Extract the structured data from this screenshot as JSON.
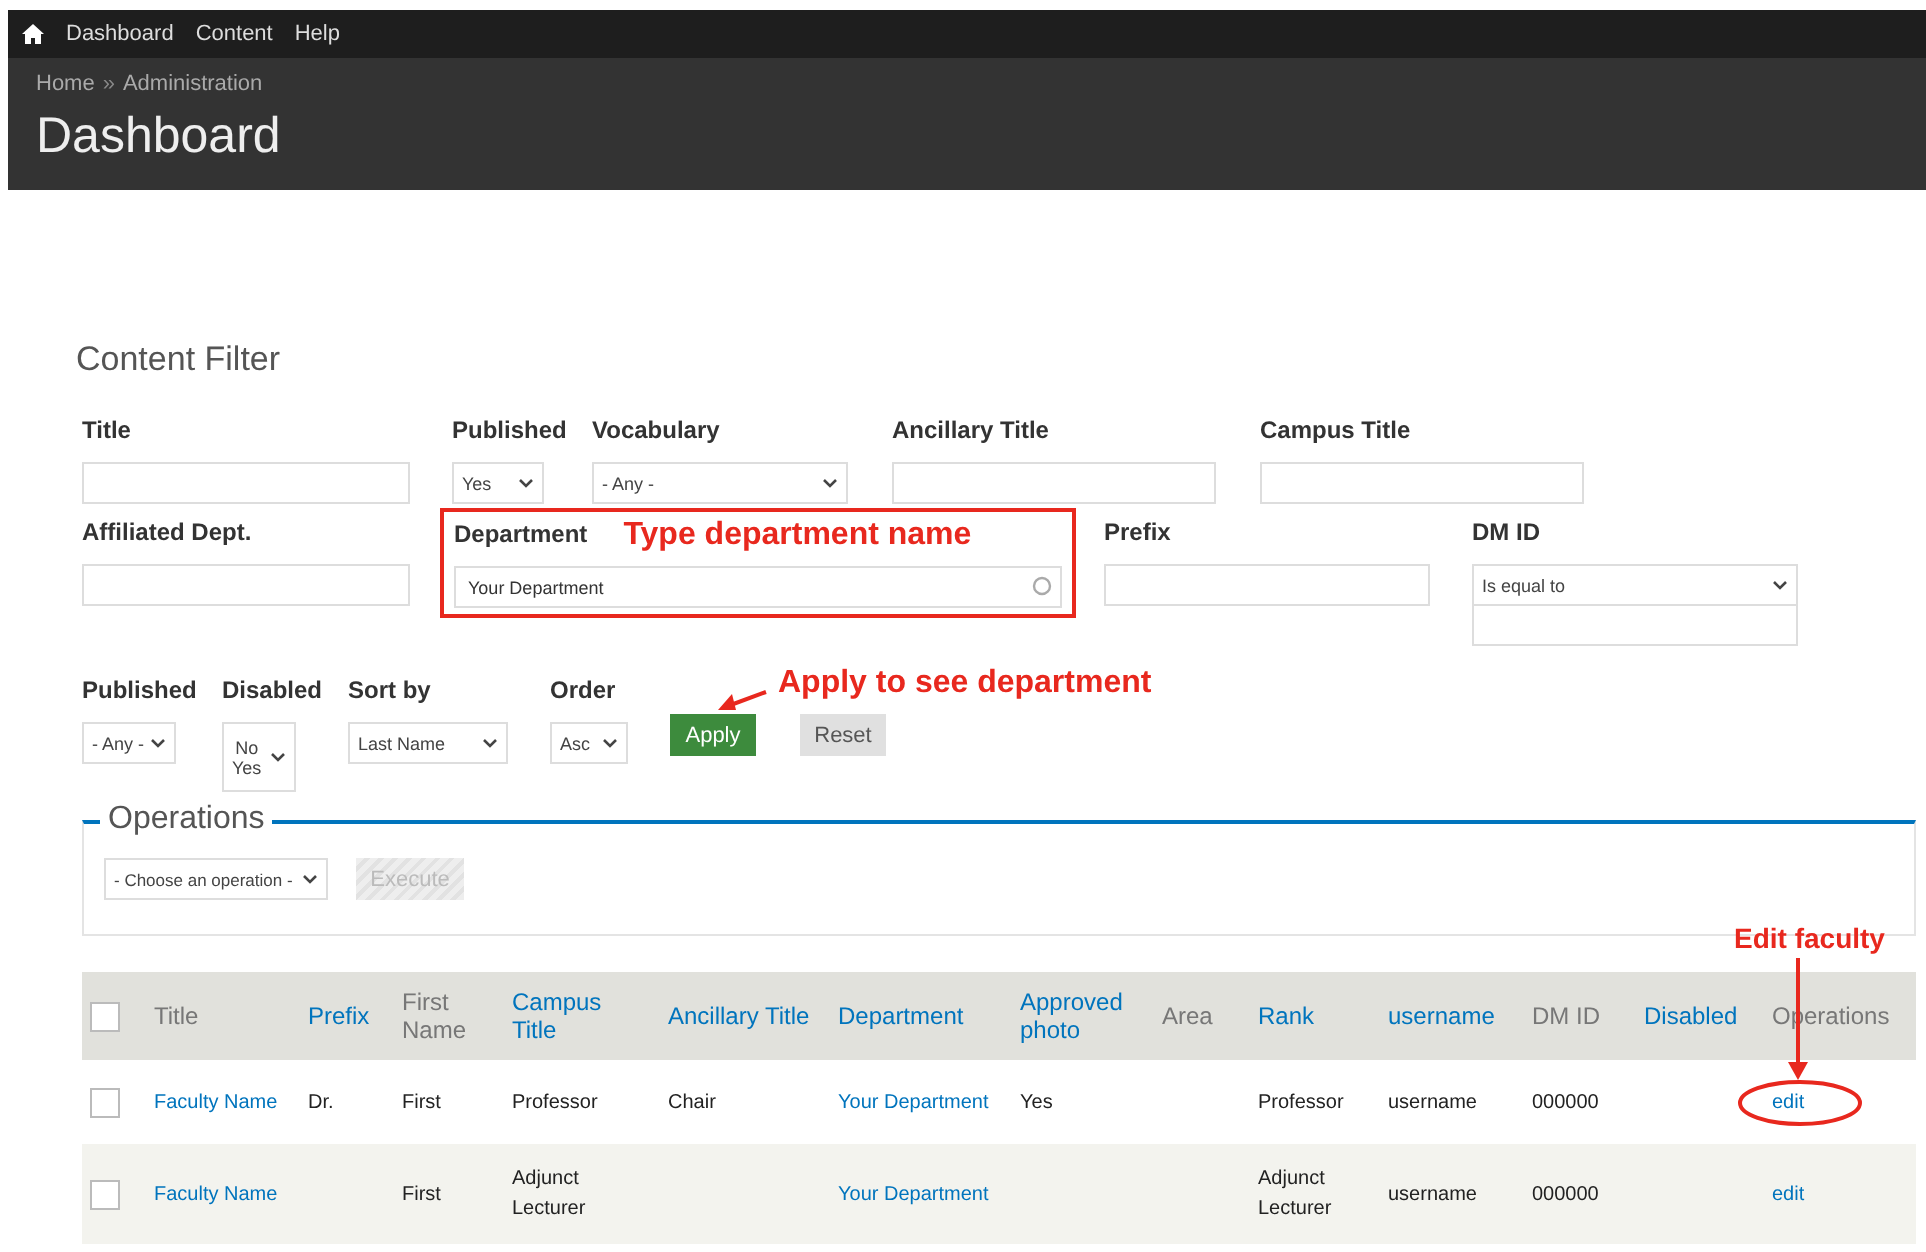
{
  "toolbar": {
    "items": [
      "Dashboard",
      "Content",
      "Help"
    ]
  },
  "header": {
    "breadcrumb": [
      "Home",
      "Administration"
    ],
    "separator": "»",
    "title": "Dashboard"
  },
  "content_filter": {
    "title": "Content Filter",
    "rows": [
      [
        {
          "label": "Title",
          "kind": "text"
        },
        {
          "label": "Published",
          "kind": "select",
          "value": "Yes"
        },
        {
          "label": "Vocabulary",
          "kind": "select",
          "value": "- Any -"
        },
        {
          "label": "Ancillary Title",
          "kind": "text"
        },
        {
          "label": "Campus Title",
          "kind": "text"
        }
      ],
      [
        {
          "label": "Affiliated Dept.",
          "kind": "text"
        },
        {
          "label": "Department",
          "kind": "autocomplete",
          "value": "Your Department",
          "highlighted": true,
          "note": "Type department name"
        },
        {
          "label": "Prefix",
          "kind": "text"
        },
        {
          "label": "DM ID",
          "kind": "operator",
          "value": "Is equal to"
        }
      ],
      [
        {
          "label": "Published",
          "kind": "select",
          "value": "- Any -"
        },
        {
          "label": "Disabled",
          "kind": "multiselect",
          "options": [
            "No",
            "Yes"
          ]
        },
        {
          "label": "Sort by",
          "kind": "select",
          "value": "Last Name"
        },
        {
          "label": "Order",
          "kind": "select",
          "value": "Asc"
        }
      ]
    ],
    "buttons": [
      {
        "label": "Apply",
        "kind": "primary"
      },
      {
        "label": "Reset",
        "kind": "secondary"
      }
    ]
  },
  "operations": {
    "legend": "Operations",
    "select": "- Choose an operation -",
    "execute": {
      "label": "Execute",
      "disabled": true
    }
  },
  "table": {
    "select_all": {
      "checked": false
    },
    "columns": [
      {
        "label": "Title",
        "sortable": false,
        "kind": "link"
      },
      {
        "label": "Prefix",
        "sortable": true,
        "kind": "plain"
      },
      {
        "label": "First Name",
        "sortable": false,
        "kind": "plain"
      },
      {
        "label": "Campus Title",
        "sortable": true,
        "kind": "plain"
      },
      {
        "label": "Ancillary Title",
        "sortable": true,
        "kind": "plain"
      },
      {
        "label": "Department",
        "sortable": true,
        "kind": "link"
      },
      {
        "label": "Approved photo",
        "sortable": true,
        "kind": "plain"
      },
      {
        "label": "Area",
        "sortable": false
      },
      {
        "label": "Rank",
        "sortable": true,
        "kind": "plain"
      },
      {
        "label": "username",
        "sortable": true,
        "kind": "plain"
      },
      {
        "label": "DM ID",
        "sortable": false,
        "kind": "plain"
      },
      {
        "label": "Disabled",
        "sortable": true
      },
      {
        "label": "Operations",
        "sortable": false,
        "kind": "link"
      }
    ],
    "rows": [
      {
        "checked": false,
        "cells": [
          "Faculty Name",
          "Dr.",
          "First",
          "Professor",
          "Chair",
          "Your Department",
          "Yes",
          "",
          "Professor",
          "username",
          "000000",
          "",
          "edit"
        ]
      },
      {
        "checked": false,
        "cells": [
          "Faculty Name",
          "",
          "First",
          "Adjunct Lecturer",
          "",
          "Your Department",
          "",
          "",
          "Adjunct Lecturer",
          "username",
          "000000",
          "",
          "edit"
        ]
      }
    ]
  },
  "annotations": [
    {
      "kind": "apply-note",
      "text": "Apply to see department"
    },
    {
      "kind": "edit-note",
      "text": "Edit faculty"
    }
  ]
}
